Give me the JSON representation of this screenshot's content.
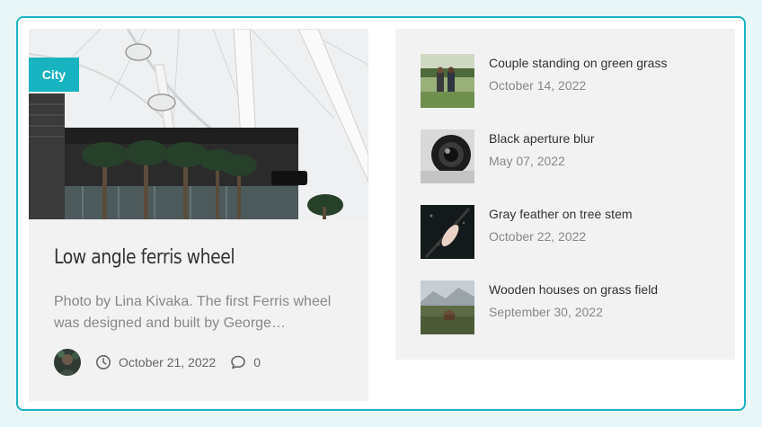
{
  "feature": {
    "category": "City",
    "title": "Low angle ferris wheel",
    "excerpt": "Photo by Lina Kivaka. The first Ferris wheel was designed and built by George…",
    "date": "October 21, 2022",
    "comments": "0",
    "image_icon": "ferris-wheel-photo",
    "clock_icon": "clock-icon",
    "comment_icon": "comment-bubble-icon",
    "accent_color": "#17b3c0"
  },
  "posts": [
    {
      "title": "Couple standing on green grass",
      "date": "October 14, 2022"
    },
    {
      "title": "Black aperture blur",
      "date": "May 07, 2022"
    },
    {
      "title": "Gray feather on tree stem",
      "date": "October 22, 2022"
    },
    {
      "title": "Wooden houses on grass field",
      "date": "September 30, 2022"
    }
  ]
}
